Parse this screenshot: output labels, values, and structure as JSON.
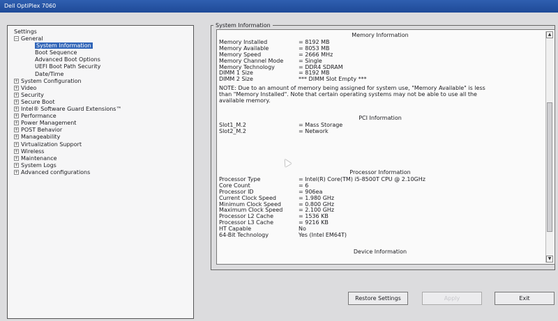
{
  "window": {
    "title": "Dell OptiPlex 7060"
  },
  "tree": {
    "root_label": "Settings",
    "items": [
      {
        "label": "General",
        "expander": "−",
        "level": 1
      },
      {
        "label": "System Information",
        "level": 2,
        "selected": true
      },
      {
        "label": "Boot Sequence",
        "level": 2
      },
      {
        "label": "Advanced Boot Options",
        "level": 2
      },
      {
        "label": "UEFI Boot Path Security",
        "level": 2
      },
      {
        "label": "Date/Time",
        "level": 2
      },
      {
        "label": "System Configuration",
        "expander": "+",
        "level": 1
      },
      {
        "label": "Video",
        "expander": "+",
        "level": 1
      },
      {
        "label": "Security",
        "expander": "+",
        "level": 1
      },
      {
        "label": "Secure Boot",
        "expander": "+",
        "level": 1
      },
      {
        "label": "Intel® Software Guard Extensions™",
        "expander": "+",
        "level": 1
      },
      {
        "label": "Performance",
        "expander": "+",
        "level": 1
      },
      {
        "label": "Power Management",
        "expander": "+",
        "level": 1
      },
      {
        "label": "POST Behavior",
        "expander": "+",
        "level": 1
      },
      {
        "label": "Manageability",
        "expander": "+",
        "level": 1
      },
      {
        "label": "Virtualization Support",
        "expander": "+",
        "level": 1
      },
      {
        "label": "Wireless",
        "expander": "+",
        "level": 1
      },
      {
        "label": "Maintenance",
        "expander": "+",
        "level": 1
      },
      {
        "label": "System Logs",
        "expander": "+",
        "level": 1
      },
      {
        "label": "Advanced configurations",
        "expander": "+",
        "level": 1
      }
    ]
  },
  "panel": {
    "title": "System Information",
    "memory": {
      "title": "Memory Information",
      "rows": [
        {
          "k": "Memory Installed",
          "v": "= 8192 MB"
        },
        {
          "k": "Memory Available",
          "v": "= 8053 MB"
        },
        {
          "k": "Memory Speed",
          "v": "= 2666 MHz"
        },
        {
          "k": "Memory Channel Mode",
          "v": "= Single"
        },
        {
          "k": "Memory Technology",
          "v": "= DDR4 SDRAM"
        },
        {
          "k": "DIMM 1 Size",
          "v": "= 8192 MB"
        },
        {
          "k": "DIMM 2 Size",
          "v": "*** DIMM Slot Empty ***"
        }
      ],
      "note": "NOTE: Due to an amount of memory being assigned for system use, \"Memory Available\" is less than \"Memory Installed\". Note that certain operating systems may not be able to use all the available memory."
    },
    "pci": {
      "title": "PCI Information",
      "rows": [
        {
          "k": "Slot1_M.2",
          "v": "= Mass Storage"
        },
        {
          "k": "Slot2_M.2",
          "v": "= Network"
        }
      ]
    },
    "processor": {
      "title": "Processor Information",
      "rows": [
        {
          "k": "Processor Type",
          "v": "= Intel(R) Core(TM) i5-8500T CPU @ 2.10GHz"
        },
        {
          "k": "Core Count",
          "v": "= 6"
        },
        {
          "k": "Processor ID",
          "v": "= 906ea"
        },
        {
          "k": "Current Clock Speed",
          "v": "= 1.980 GHz"
        },
        {
          "k": "Minimum Clock Speed",
          "v": "= 0.800 GHz"
        },
        {
          "k": "Maximum Clock Speed",
          "v": "= 2.100 GHz"
        },
        {
          "k": "Processor L2 Cache",
          "v": "= 1536 KB"
        },
        {
          "k": "Processor L3 Cache",
          "v": "= 9216 KB"
        },
        {
          "k": "HT Capable",
          "v": "No"
        },
        {
          "k": "64-Bit Technology",
          "v": "Yes (Intel EM64T)"
        }
      ]
    },
    "device": {
      "title": "Device Information"
    }
  },
  "buttons": {
    "restore": "Restore Settings",
    "apply": "Apply",
    "exit": "Exit"
  }
}
